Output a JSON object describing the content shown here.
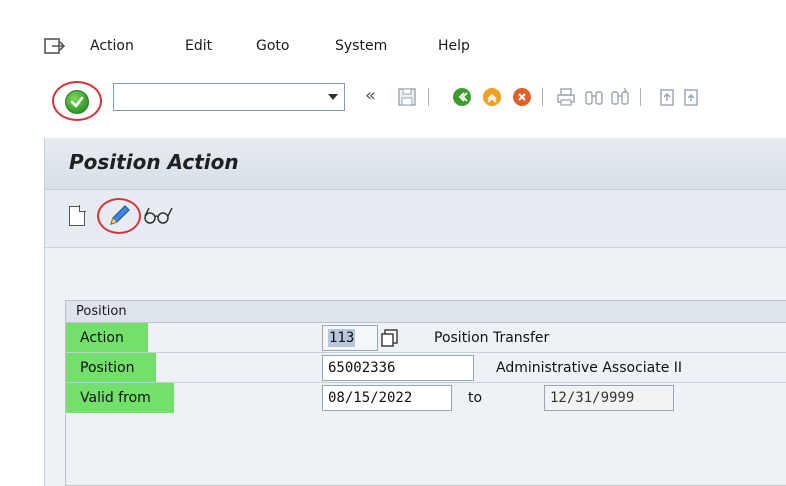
{
  "menu": {
    "items": [
      {
        "label": "Action"
      },
      {
        "label": "Edit"
      },
      {
        "label": "Goto"
      },
      {
        "label": "System"
      },
      {
        "label": "Help"
      }
    ]
  },
  "toolbar": {
    "command_field_value": "",
    "back_label": "«"
  },
  "screen": {
    "title": "Position Action"
  },
  "group": {
    "title": "Position",
    "rows": {
      "action": {
        "label": "Action",
        "value": "113",
        "description": "Position Transfer"
      },
      "position": {
        "label": "Position",
        "value": "65002336",
        "description": "Administrative Associate II"
      },
      "valid_from": {
        "label": "Valid from",
        "value": "08/15/2022",
        "to_label": "to",
        "to_value": "12/31/9999"
      }
    }
  },
  "colors": {
    "highlight_green": "#73e06b",
    "annotation_red": "#d6343a",
    "title_bar": "#d7dfe7"
  }
}
